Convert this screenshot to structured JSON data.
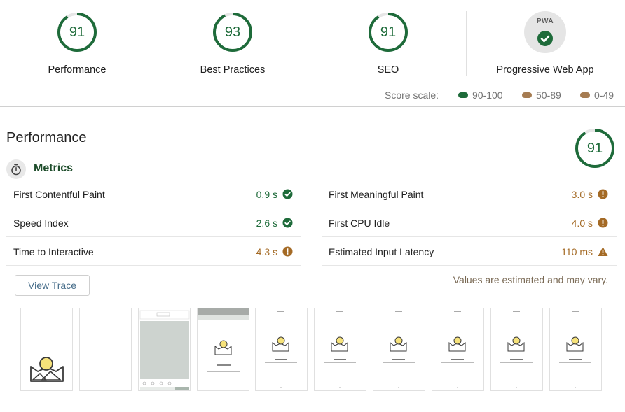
{
  "gauges": [
    {
      "label": "Performance",
      "score": "91"
    },
    {
      "label": "Best Practices",
      "score": "93"
    },
    {
      "label": "SEO",
      "score": "91"
    },
    {
      "label": "Progressive Web App",
      "badge": "PWA"
    }
  ],
  "score_scale": {
    "label": "Score scale:",
    "ranges": [
      {
        "label": "90-100",
        "color": "#1e6b3a"
      },
      {
        "label": "50-89",
        "color": "#a67c52"
      },
      {
        "label": "0-49",
        "color": "#a67c52"
      }
    ]
  },
  "performance": {
    "title": "Performance",
    "score": "91",
    "metrics_title": "Metrics",
    "metrics": [
      {
        "name": "First Contentful Paint",
        "value": "0.9 s",
        "status": "pass",
        "icon": "check-circle-icon"
      },
      {
        "name": "First Meaningful Paint",
        "value": "3.0 s",
        "status": "average",
        "icon": "info-circle-icon"
      },
      {
        "name": "Speed Index",
        "value": "2.6 s",
        "status": "pass",
        "icon": "check-circle-icon"
      },
      {
        "name": "First CPU Idle",
        "value": "4.0 s",
        "status": "average",
        "icon": "info-circle-icon"
      },
      {
        "name": "Time to Interactive",
        "value": "4.3 s",
        "status": "average",
        "icon": "info-circle-icon"
      },
      {
        "name": "Estimated Input Latency",
        "value": "110 ms",
        "status": "average",
        "icon": "warning-triangle-icon"
      }
    ],
    "view_trace_label": "View Trace",
    "estimate_note": "Values are estimated and may vary."
  },
  "colors": {
    "pass": "#1e6b3a",
    "average": "#a46a25",
    "gauge_track": "#e6e6e6"
  }
}
